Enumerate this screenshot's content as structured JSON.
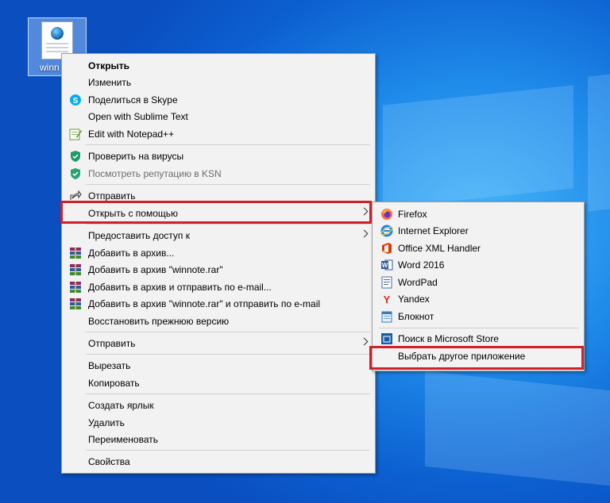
{
  "desktop": {
    "file": {
      "label": "winn",
      "icon": "html-file-icon"
    }
  },
  "context_menu": {
    "items": [
      {
        "label": "Открыть",
        "bold": true,
        "icon": null
      },
      {
        "label": "Изменить",
        "icon": null
      },
      {
        "label": "Поделиться в Skype",
        "icon": "skype-icon"
      },
      {
        "label": "Open with Sublime Text",
        "icon": null
      },
      {
        "label": "Edit with Notepad++",
        "icon": "notepadpp-icon"
      },
      {
        "label": "Проверить на вирусы",
        "icon": "kaspersky-shield-icon"
      },
      {
        "label": "Посмотреть репутацию в KSN",
        "icon": "kaspersky-shield-icon",
        "disabled": true
      },
      {
        "label": "Отправить",
        "icon": "share-icon"
      },
      {
        "label": "Открыть с помощью",
        "icon": null,
        "submenu": true,
        "highlighted": true
      },
      {
        "label": "Предоставить доступ к",
        "icon": null,
        "submenu": true
      },
      {
        "label": "Добавить в архив...",
        "icon": "winrar-icon"
      },
      {
        "label": "Добавить в архив \"winnote.rar\"",
        "icon": "winrar-icon"
      },
      {
        "label": "Добавить в архив и отправить по e-mail...",
        "icon": "winrar-icon"
      },
      {
        "label": "Добавить в архив \"winnote.rar\" и отправить по e-mail",
        "icon": "winrar-icon"
      },
      {
        "label": "Восстановить прежнюю версию",
        "icon": null
      },
      {
        "label": "Отправить",
        "icon": null,
        "submenu": true
      },
      {
        "label": "Вырезать",
        "icon": null
      },
      {
        "label": "Копировать",
        "icon": null
      },
      {
        "label": "Создать ярлык",
        "icon": null
      },
      {
        "label": "Удалить",
        "icon": null
      },
      {
        "label": "Переименовать",
        "icon": null
      },
      {
        "label": "Свойства",
        "icon": null
      }
    ]
  },
  "open_with_submenu": {
    "items": [
      {
        "label": "Firefox",
        "icon": "firefox-icon"
      },
      {
        "label": "Internet Explorer",
        "icon": "internet-explorer-icon"
      },
      {
        "label": "Office XML Handler",
        "icon": "office-icon"
      },
      {
        "label": "Word 2016",
        "icon": "word-icon"
      },
      {
        "label": "WordPad",
        "icon": "wordpad-icon"
      },
      {
        "label": "Yandex",
        "icon": "yandex-icon"
      },
      {
        "label": "Блокнот",
        "icon": "notepad-icon"
      },
      {
        "label": "Поиск в Microsoft Store",
        "icon": "microsoft-store-icon"
      },
      {
        "label": "Выбрать другое приложение",
        "icon": null,
        "highlighted": true
      }
    ]
  },
  "colors": {
    "highlight_frame": "#d0202a",
    "menu_bg": "#f2f2f2",
    "desktop_blue": "#0c5fd0"
  }
}
